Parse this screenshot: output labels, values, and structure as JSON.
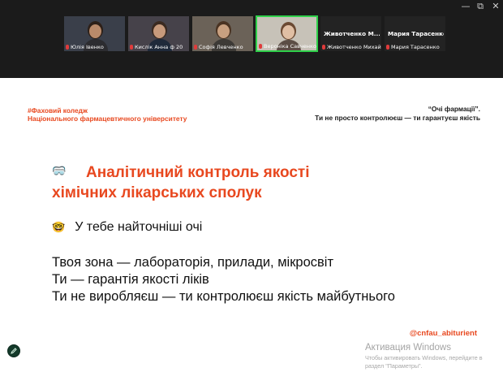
{
  "window_controls": {
    "minimize": "—",
    "maximize": "⧉",
    "close": "✕"
  },
  "participants": [
    {
      "name": "Юлія Івенко",
      "muted": true,
      "camera": true,
      "skin": "#b98a6a",
      "hair": "#2d2018",
      "bg": "#3a3f4a",
      "shirt": "#2c2c30"
    },
    {
      "name": "Кислік Анна ф 20",
      "muted": true,
      "camera": true,
      "skin": "#c79a7c",
      "hair": "#3b2a20",
      "bg": "#46424a",
      "shirt": "#1f2a3a"
    },
    {
      "name": "Софія Левченко",
      "muted": true,
      "camera": true,
      "skin": "#c8a080",
      "hair": "#4a3322",
      "bg": "#6b6258",
      "shirt": "#3d3a36"
    },
    {
      "name": "Вероніка Савченко",
      "muted": true,
      "camera": true,
      "active": true,
      "skin": "#e0bfa4",
      "hair": "#6b4a33",
      "bg": "#c7c2b8",
      "shirt": "#5b4d45"
    },
    {
      "name": "Животченко Михайло",
      "big_name": "Животченко М...",
      "muted": true,
      "camera": false
    },
    {
      "name": "Мария Тарасенко",
      "big_name": "Мария Тарасенко",
      "muted": true,
      "camera": false
    }
  ],
  "slide": {
    "brand_line1": "#Фаховий коледж",
    "brand_line2": "Національного фармацевтичного університету",
    "quote_line1": "“Очі фармації”.",
    "quote_line2": "Ти не просто контролюєш — ти гарантуєш якість",
    "title_icon": "🥽",
    "title_line1": "Аналітичний контроль якості",
    "title_line2": "хімічних лікарських сполук",
    "sub_icon": "🤓",
    "subline": "У тебе найточніші очі",
    "body_line1": "Твоя зона — лабораторія, прилади, мікросвіт",
    "body_line2": "Ти — гарантія якості ліків",
    "body_line3": "Ти не виробляєш — ти контролюєш якість майбутнього",
    "handle": "@cnfau_abiturient"
  },
  "watermark": {
    "title": "Активация Windows",
    "line1": "Чтобы активировать Windows, перейдите в",
    "line2": "раздел \"Параметры\"."
  },
  "annotate_button_icon": "pen-icon",
  "colors": {
    "accent": "#e8481f",
    "active_speaker": "#2fd04a",
    "app_bg": "#1b1b1b"
  }
}
